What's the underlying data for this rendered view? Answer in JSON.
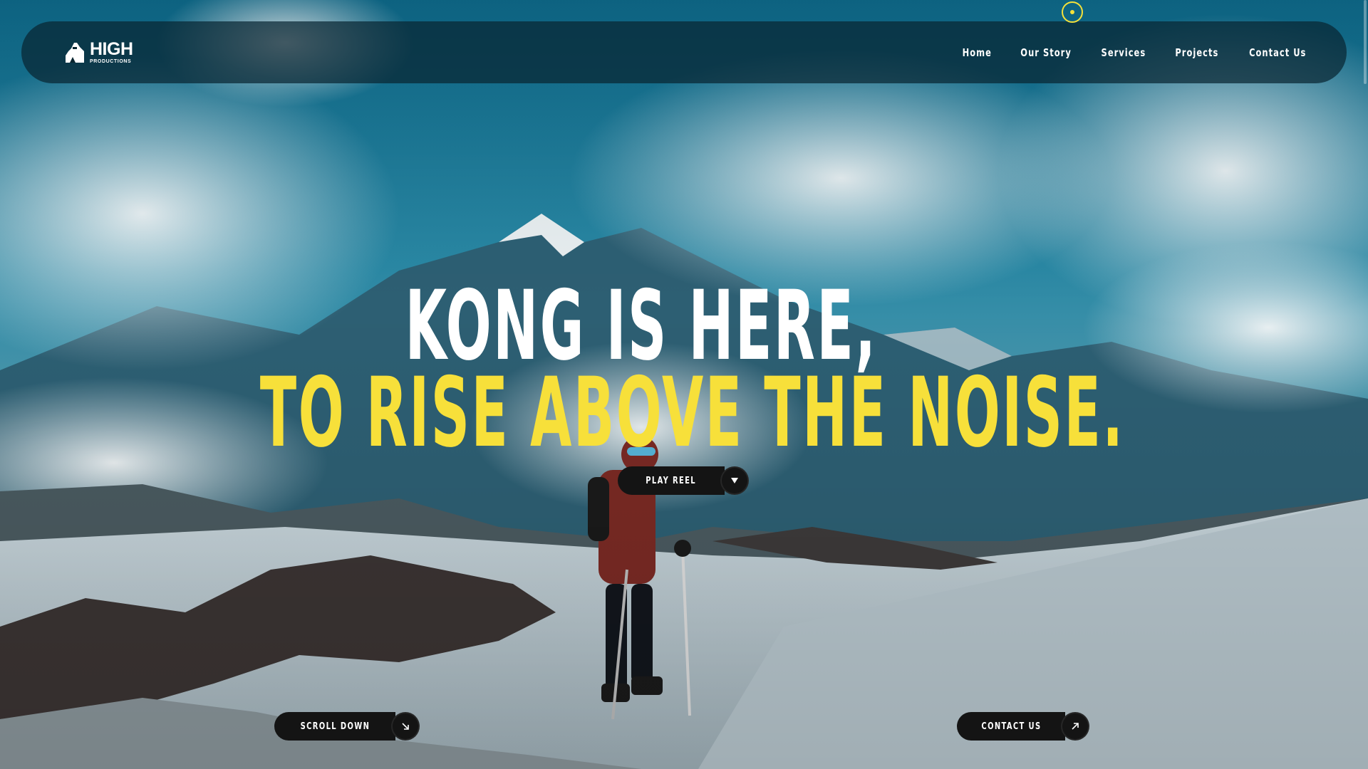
{
  "brand": {
    "name": "HIGH",
    "sub": "PRODUCTIONS",
    "icon": "gorilla-logo-icon"
  },
  "nav": {
    "items": [
      {
        "label": "Home"
      },
      {
        "label": "Our Story"
      },
      {
        "label": "Services"
      },
      {
        "label": "Projects"
      },
      {
        "label": "Contact Us"
      }
    ]
  },
  "hero": {
    "line1": "KONG IS HERE,",
    "line2": "TO RISE ABOVE THE NOISE."
  },
  "buttons": {
    "play_reel": {
      "label": "PLAY REEL",
      "icon": "triangle-down-icon"
    },
    "scroll_down": {
      "label": "SCROLL DOWN",
      "icon": "arrow-down-right-icon"
    },
    "contact_us": {
      "label": "CONTACT US",
      "icon": "arrow-up-right-icon"
    }
  },
  "colors": {
    "accent": "#f7e03a",
    "navbar": "#082632",
    "button": "#141414",
    "text": "#ffffff"
  }
}
